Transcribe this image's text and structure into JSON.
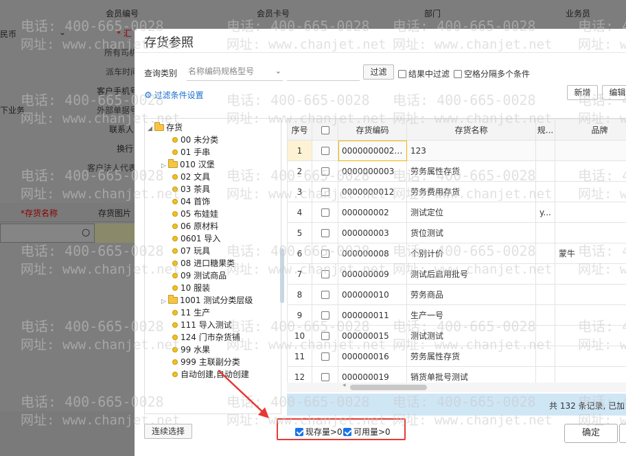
{
  "background": {
    "member_no": "会员编号",
    "member_card": "会员卡号",
    "department": "部门",
    "salesman": "业务员",
    "currency": "民币",
    "summary": "* 汇",
    "all_owner": "所有司机",
    "dispatch_time": "派车时间",
    "customer_mobile": "客户手机号",
    "external_no": "外部单据号",
    "contact": "联系人",
    "next_business": "下业务",
    "exchange": "换行",
    "legal_rep": "客户法人代表",
    "col_inventory_name": "*存货名称",
    "col_inventory_image": "存货图片"
  },
  "watermark": {
    "phone": "电话: 400-665-0028",
    "site": "网址: www.chanjet.net"
  },
  "dialog": {
    "title": "存货参照",
    "query_label": "查询类别",
    "query_placeholder": "名称编码规格型号",
    "filter_button": "过滤",
    "opt_filter_in_result": "结果中过滤",
    "opt_space_split": "空格分隔多个条件",
    "filter_settings_link": "过滤条件设置",
    "new_button": "新增",
    "edit_button": "编辑",
    "continuous_select": "连续选择",
    "stock_gt0": "现存量>0",
    "available_gt0": "可用量>0",
    "confirm": "确定",
    "footer_text": "共 132 条记录, 已加"
  },
  "tree": {
    "root": "存货",
    "items": [
      {
        "label": "00 未分类",
        "type": "leaf"
      },
      {
        "label": "01 手串",
        "type": "leaf"
      },
      {
        "label": "010 汉堡",
        "type": "folder"
      },
      {
        "label": "02 文具",
        "type": "leaf"
      },
      {
        "label": "03 茶具",
        "type": "leaf"
      },
      {
        "label": "04 首饰",
        "type": "leaf"
      },
      {
        "label": "05 布娃娃",
        "type": "leaf"
      },
      {
        "label": "06 原材料",
        "type": "leaf"
      },
      {
        "label": "0601 导入",
        "type": "leaf"
      },
      {
        "label": "07 玩具",
        "type": "leaf"
      },
      {
        "label": "08 进口糖果类",
        "type": "leaf"
      },
      {
        "label": "09 测试商品",
        "type": "leaf"
      },
      {
        "label": "10 服装",
        "type": "leaf"
      },
      {
        "label": "1001 测试分类层级",
        "type": "folder"
      },
      {
        "label": "11 生产",
        "type": "leaf"
      },
      {
        "label": "111 导入测试",
        "type": "leaf"
      },
      {
        "label": "124 门市杂货铺",
        "type": "leaf"
      },
      {
        "label": "99 水果",
        "type": "leaf"
      },
      {
        "label": "999 主联副分类",
        "type": "leaf"
      },
      {
        "label": "自动创建,自动创建",
        "type": "leaf"
      }
    ]
  },
  "table": {
    "headers": [
      "序号",
      "",
      "存货编码",
      "存货名称",
      "规...",
      "品牌"
    ],
    "rows": [
      {
        "idx": "1",
        "code": "00000000022...",
        "name": "123",
        "spec": "",
        "brand": ""
      },
      {
        "idx": "2",
        "code": "0000000003",
        "name": "劳务属性存货",
        "spec": "",
        "brand": ""
      },
      {
        "idx": "3",
        "code": "0000000012",
        "name": "劳务费用存货",
        "spec": "",
        "brand": ""
      },
      {
        "idx": "4",
        "code": "000000002",
        "name": "测试定位",
        "spec": "y...",
        "brand": ""
      },
      {
        "idx": "5",
        "code": "000000003",
        "name": "货位测试",
        "spec": "",
        "brand": ""
      },
      {
        "idx": "6",
        "code": "000000008",
        "name": "个别计价",
        "spec": "",
        "brand": "蒙牛"
      },
      {
        "idx": "7",
        "code": "000000009",
        "name": "测试后启用批号",
        "spec": "",
        "brand": ""
      },
      {
        "idx": "8",
        "code": "000000010",
        "name": "劳务商品",
        "spec": "",
        "brand": ""
      },
      {
        "idx": "9",
        "code": "000000011",
        "name": "生产一号",
        "spec": "",
        "brand": ""
      },
      {
        "idx": "10",
        "code": "000000015",
        "name": "测试测试",
        "spec": "",
        "brand": ""
      },
      {
        "idx": "11",
        "code": "000000016",
        "name": "劳务属性存货",
        "spec": "",
        "brand": ""
      },
      {
        "idx": "12",
        "code": "000000019",
        "name": "销货单批号测试",
        "spec": "",
        "brand": ""
      }
    ]
  },
  "colors": {
    "accent": "#1a73e8",
    "highlight_box": "#e53935",
    "footer_bar": "#cfe6f5"
  }
}
